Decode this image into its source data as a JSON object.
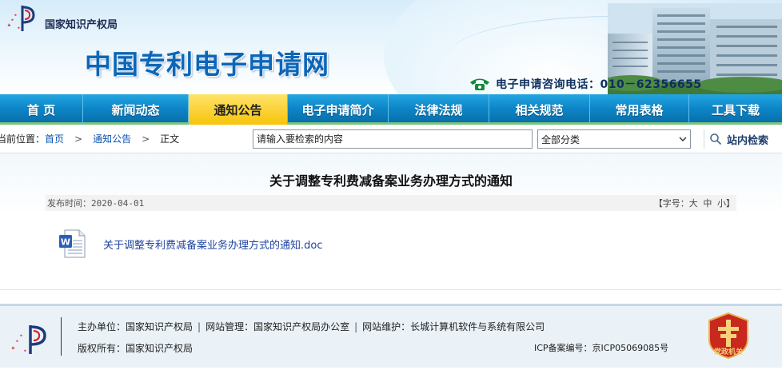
{
  "header": {
    "org_name": "国家知识产权局",
    "site_title": "中国专利电子申请网",
    "hotline_label": "电子申请咨询电话：010－62356655"
  },
  "nav": {
    "items": [
      {
        "label": "首  页",
        "active": false
      },
      {
        "label": "新闻动态",
        "active": false
      },
      {
        "label": "通知公告",
        "active": true
      },
      {
        "label": "电子申请简介",
        "active": false
      },
      {
        "label": "法律法规",
        "active": false
      },
      {
        "label": "相关规范",
        "active": false
      },
      {
        "label": "常用表格",
        "active": false
      },
      {
        "label": "工具下载",
        "active": false
      }
    ]
  },
  "breadcrumb": {
    "prefix": "当前位置：",
    "home": "首页",
    "section": "通知公告",
    "current": "正文",
    "separator": ">"
  },
  "search": {
    "placeholder": "请输入要检索的内容",
    "category_selected": "全部分类",
    "button_label": "站内检索"
  },
  "article": {
    "title": "关于调整专利费减备案业务办理方式的通知",
    "publish_time": "发布时间：2020-04-01",
    "font_size_control": "【字号：大 中 小】",
    "attachment_name": "关于调整专利费减备案业务办理方式的通知.doc"
  },
  "footer": {
    "host": "主办单位：国家知识产权局",
    "manager": "网站管理：国家知识产权局办公室",
    "maintainer": "网站维护：长城计算机软件与系统有限公司",
    "copyright": "版权所有：国家知识产权局",
    "icp": "ICP备案编号：京ICP05069085号",
    "bar": "|",
    "badge_text": "党政机关"
  },
  "colors": {
    "brand_blue": "#0b66b8",
    "nav_blue": "#0c86c8",
    "nav_active": "#f6c40a",
    "link": "#0a55b0"
  }
}
